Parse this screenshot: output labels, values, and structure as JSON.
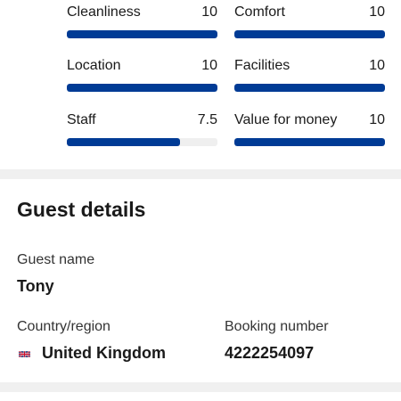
{
  "ratings": [
    {
      "label": "Cleanliness",
      "score": "10",
      "value": 10
    },
    {
      "label": "Comfort",
      "score": "10",
      "value": 10
    },
    {
      "label": "Location",
      "score": "10",
      "value": 10
    },
    {
      "label": "Facilities",
      "score": "10",
      "value": 10
    },
    {
      "label": "Staff",
      "score": "7.5",
      "value": 7.5
    },
    {
      "label": "Value for money",
      "score": "10",
      "value": 10
    }
  ],
  "rating_max": 10,
  "guest_details": {
    "title": "Guest details",
    "guest_name_label": "Guest name",
    "guest_name": "Tony",
    "country_label": "Country/region",
    "country": "United Kingdom",
    "country_flag_icon": "uk-flag-icon",
    "booking_label": "Booking number",
    "booking_number": "4222254097"
  },
  "colors": {
    "bar_fill": "#003b95",
    "bar_track": "#efefef",
    "section_divider": "#f0f0f0"
  }
}
